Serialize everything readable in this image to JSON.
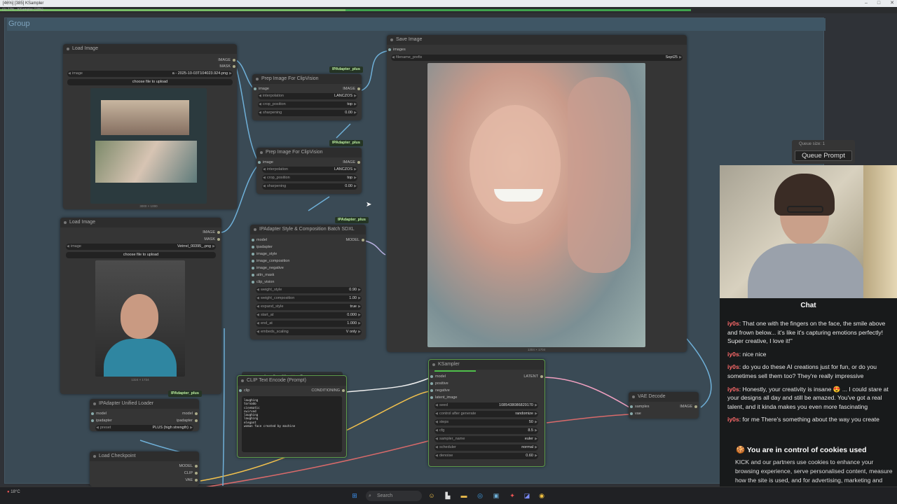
{
  "window": {
    "title": "[46%] [385] KSampler",
    "progress_text": "(1) 77% - KSampler (10%)",
    "progress_values": {
      "overall": 0.77,
      "node": 0.1
    }
  },
  "group": {
    "title": "Group"
  },
  "nodes": {
    "load_image_1": {
      "title": "Load Image",
      "out_image": "IMAGE",
      "out_mask": "MASK",
      "image_label": "image",
      "image_value": "a - 2025-10-03T104023.924.png",
      "upload": "choose file to upload",
      "caption": "3000 × 1000"
    },
    "load_image_2": {
      "title": "Load Image",
      "out_image": "IMAGE",
      "out_mask": "MASK",
      "image_label": "image",
      "image_value": "Vetrrel_00395_.png",
      "upload": "choose file to upload",
      "caption": "1324 × 1724"
    },
    "prep1": {
      "title": "Prep Image For ClipVision",
      "tag": "IPAdapter_plus",
      "in_image": "image",
      "out_image": "IMAGE",
      "w1_l": "interpolation",
      "w1_v": "LANCZOS",
      "w2_l": "crop_position",
      "w2_v": "top",
      "w3_l": "sharpening",
      "w3_v": "0.00"
    },
    "prep2": {
      "title": "Prep Image For ClipVision",
      "tag": "IPAdapter_plus",
      "in_image": "image",
      "out_image": "IMAGE",
      "w1_l": "interpolation",
      "w1_v": "LANCZOS",
      "w2_l": "crop_position",
      "w2_v": "top",
      "w3_l": "sharpening",
      "w3_v": "0.00"
    },
    "ipa_style": {
      "title": "IPAdapter Style & Composition Batch SDXL",
      "tag": "IPAdapter_plus",
      "out_model": "MODEL",
      "inputs": [
        "model",
        "ipadapter",
        "image_style",
        "image_composition",
        "image_negative",
        "attn_mask",
        "clip_vision"
      ],
      "widgets": [
        {
          "l": "weight_style",
          "v": "0.90"
        },
        {
          "l": "weight_composition",
          "v": "1.00"
        },
        {
          "l": "expand_style",
          "v": "true"
        },
        {
          "l": "start_at",
          "v": "0.000"
        },
        {
          "l": "end_at",
          "v": "1.000"
        },
        {
          "l": "embeds_scaling",
          "v": "V only"
        }
      ]
    },
    "save_image": {
      "title": "Save Image",
      "in_images": "images",
      "w_l": "filename_prefix",
      "w_v": "Sept25",
      "caption": "1304 × 1704"
    },
    "unified_loader": {
      "title": "IPAdapter Unified Loader",
      "tag": "IPAdapter_plus",
      "in_model": "model",
      "in_ipadapter": "ipadapter",
      "out_model": "model",
      "out_ipadapter": "ipadapter",
      "w_l": "preset",
      "w_v": "PLUS (high strength)"
    },
    "checkpoint": {
      "title": "Load Checkpoint",
      "out_model": "MODEL",
      "out_clip": "CLIP",
      "out_vae": "VAE"
    },
    "clip_encode": {
      "title": "CLIP Text Encode (Prompt)",
      "in_clip": "clip",
      "out": "CONDITIONING",
      "text": "laughing\ntornado\ncinematic\nswirved\nlaughing\nlaughing\nelegant\nwoman face created by machine"
    },
    "ksampler": {
      "title": "KSampler",
      "out": "LATENT",
      "inputs": [
        "model",
        "positive",
        "negative",
        "latent_image"
      ],
      "widgets": [
        {
          "l": "seed",
          "v": "1085438086829170"
        },
        {
          "l": "control after generate",
          "v": "randomize"
        },
        {
          "l": "steps",
          "v": "50"
        },
        {
          "l": "cfg",
          "v": "8.5"
        },
        {
          "l": "sampler_name",
          "v": "euler"
        },
        {
          "l": "scheduler",
          "v": "normal"
        },
        {
          "l": "denoise",
          "v": "0.60"
        }
      ]
    },
    "vae_decode": {
      "title": "VAE Decode",
      "in_samples": "samples",
      "in_vae": "vae",
      "out": "IMAGE"
    }
  },
  "queue": {
    "size_text": "Queue size: 1",
    "button": "Queue Prompt"
  },
  "chat": {
    "title": "Chat",
    "messages": [
      {
        "user": "iy0s",
        "text": ": That one with the fingers on the face, the smile above and frown below... it's like it's capturing emotions perfectly! Super creative, I love it!\""
      },
      {
        "user": "iy0s",
        "text": ": nice nice"
      },
      {
        "user": "iy0s",
        "text": ": do you do these AI creations just for fun, or do you sometimes sell them too? They're really impressive"
      },
      {
        "user": "iy0s",
        "text": ": Honestly, your creativity is insane 😍 ... I could stare at your designs all day and still be amazed. You've got a real talent, and it kinda makes you even more fascinating"
      },
      {
        "user": "iy0s",
        "text": ": for me There's something about the way you create"
      }
    ]
  },
  "cookie": {
    "title": "You are in control of cookies used",
    "body": "KICK and our partners use cookies to enhance your browsing experience, serve personalised content, measure how the site is used, and for advertising, marketing and social media purposes."
  },
  "taskbar": {
    "search": "Search",
    "weather": "18°C"
  },
  "toolbar_icons": [
    "play-icon",
    "record-icon",
    "pin-icon",
    "bookmark-icon",
    "expand-icon",
    "delete-icon",
    "help-icon"
  ],
  "colors": {
    "group_bg": "#3a4a55",
    "node_bg": "#353535",
    "ksampler_border": "#5c9a4a",
    "clip_border": "#5c9a4a",
    "accent_red": "#ff6b6b"
  }
}
